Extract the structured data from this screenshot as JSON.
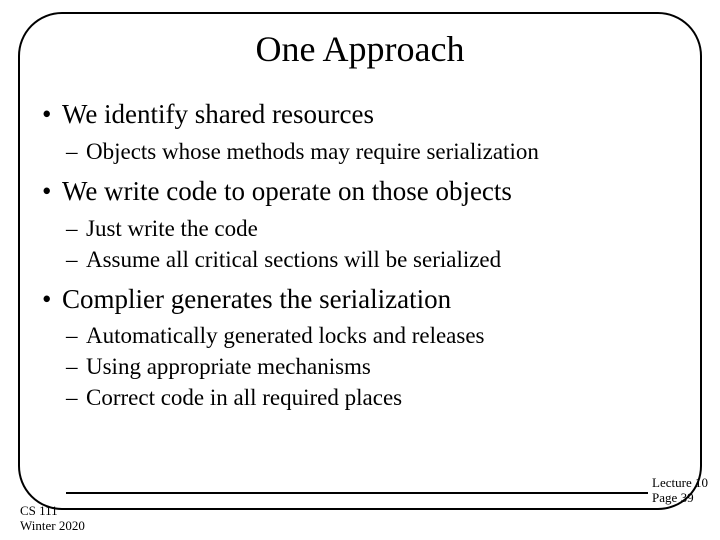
{
  "title": "One Approach",
  "bullets": {
    "b1": "We identify shared resources",
    "b1s1": "Objects whose methods may require serialization",
    "b2": "We write code to operate on those objects",
    "b2s1": "Just write the code",
    "b2s2": "Assume all critical sections will be serialized",
    "b3": "Complier generates the serialization",
    "b3s1": "Automatically generated locks and releases",
    "b3s2": "Using appropriate mechanisms",
    "b3s3": "Correct code in all required places"
  },
  "footer": {
    "course": "CS 111",
    "term": "Winter 2020",
    "lecture": "Lecture 10",
    "page": "Page 39"
  }
}
